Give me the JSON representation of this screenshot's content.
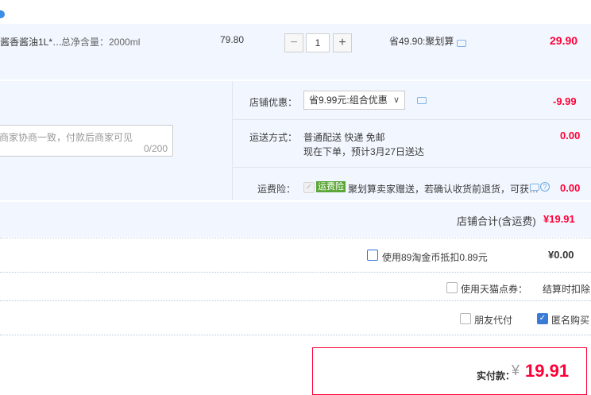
{
  "item": {
    "title": "酱香酱油1L*…",
    "spec": "总净含量：2000ml",
    "unit_price": "79.80",
    "quantity": "1",
    "minus": "−",
    "plus": "+",
    "discount": "省49.90:聚划算",
    "subtotal": "29.90"
  },
  "shop": {
    "promo_label": "店铺优惠：",
    "promo_selected": "省9.99元:组合优惠",
    "promo_amount": "-9.99",
    "message_placeholder": "商家协商一致，付款后商家可见",
    "message_counter": "0/200",
    "shipping_label": "运送方式：",
    "shipping_method": "普通配送 快递 免邮",
    "shipping_eta": "现在下单，预计3月27日送达",
    "shipping_amount": "0.00",
    "insurance_label": "运费险：",
    "insurance_badge": "运费险",
    "insurance_text": "聚划算卖家赠送，若确认收货前退货，可获…",
    "insurance_amount": "0.00",
    "total_label": "店铺合计(含运费)",
    "total_value": "¥19.91"
  },
  "options": {
    "coins_label": "使用89淘金币抵扣0.89元",
    "coins_value": "¥0.00",
    "tmall_points_label": "使用天猫点券：",
    "tmall_points_value": "结算时扣除",
    "friend_pay_label": "朋友代付",
    "anonymous_label": "匿名购买"
  },
  "payment": {
    "label": "实付款：",
    "currency": "¥",
    "amount": "19.91"
  },
  "colors": {
    "accent_red": "#ff0036",
    "accent_blue": "#3a7bd5",
    "row_bg": "#f2f7ff",
    "badge_green": "#5aa637"
  },
  "icons": [
    "info-dot-icon",
    "chat-icon",
    "help-icon",
    "caret-down-icon",
    "checkmark-icon"
  ]
}
